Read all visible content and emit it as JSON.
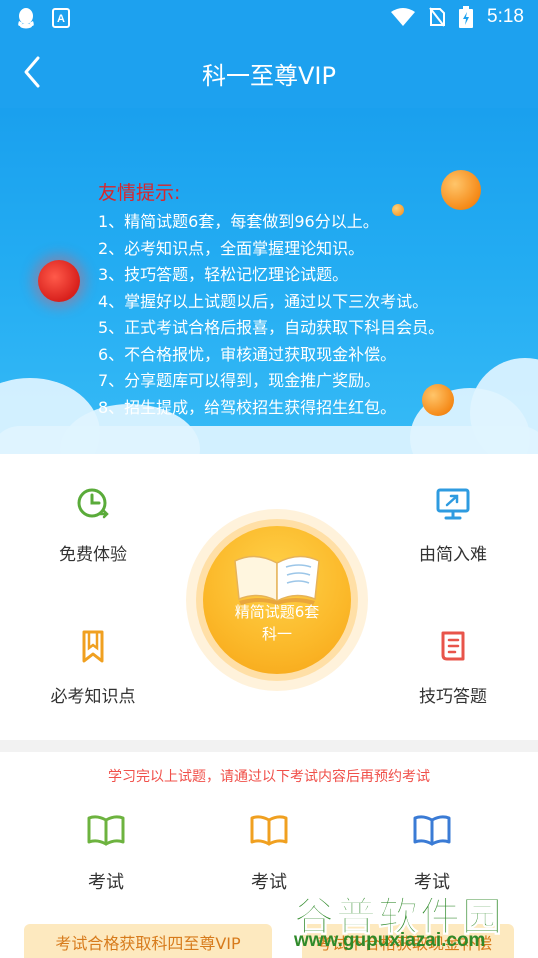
{
  "status_bar": {
    "time": "5:18",
    "icons": [
      "qq-icon",
      "font-app-icon",
      "wifi-icon",
      "no-sim-icon",
      "battery-charging-icon"
    ]
  },
  "header": {
    "title": "科一至尊VIP",
    "back_icon": "chevron-left-icon"
  },
  "banner": {
    "tips_title": "友情提示:",
    "tips": [
      "1、精简试题6套，每套做到96分以上。",
      "2、必考知识点，全面掌握理论知识。",
      "3、技巧答题，轻松记忆理论试题。",
      "4、掌握好以上试题以后，通过以下三次考试。",
      "5、正式考试合格后报喜，自动获取下科目会员。",
      "6、不合格报忧，审核通过获取现金补偿。",
      "7、分享题库可以得到，现金推广奖励。",
      "8、招生提成，给驾校招生获得招生红包。"
    ]
  },
  "features": {
    "free_trial": "免费体验",
    "easy_to_hard": "由简入难",
    "must_know": "必考知识点",
    "skill_answer": "技巧答题",
    "center_line1": "精简试题6套",
    "center_line2": "科一"
  },
  "exams": {
    "notice": "学习完以上试题，请通过以下考试内容后再预约考试",
    "items": [
      "考试",
      "考试",
      "考试"
    ],
    "vip_button": "考试合格获取科四至尊VIP",
    "vip_button2": "考试不合格获取现金补偿"
  },
  "watermark": {
    "cn": "谷普软件园",
    "en": "www.gupuxiazai.com"
  },
  "colors": {
    "primary": "#1da1ef",
    "accent_orange": "#fbb829",
    "tip_red": "#d9262b",
    "green": "#5aab3a"
  }
}
